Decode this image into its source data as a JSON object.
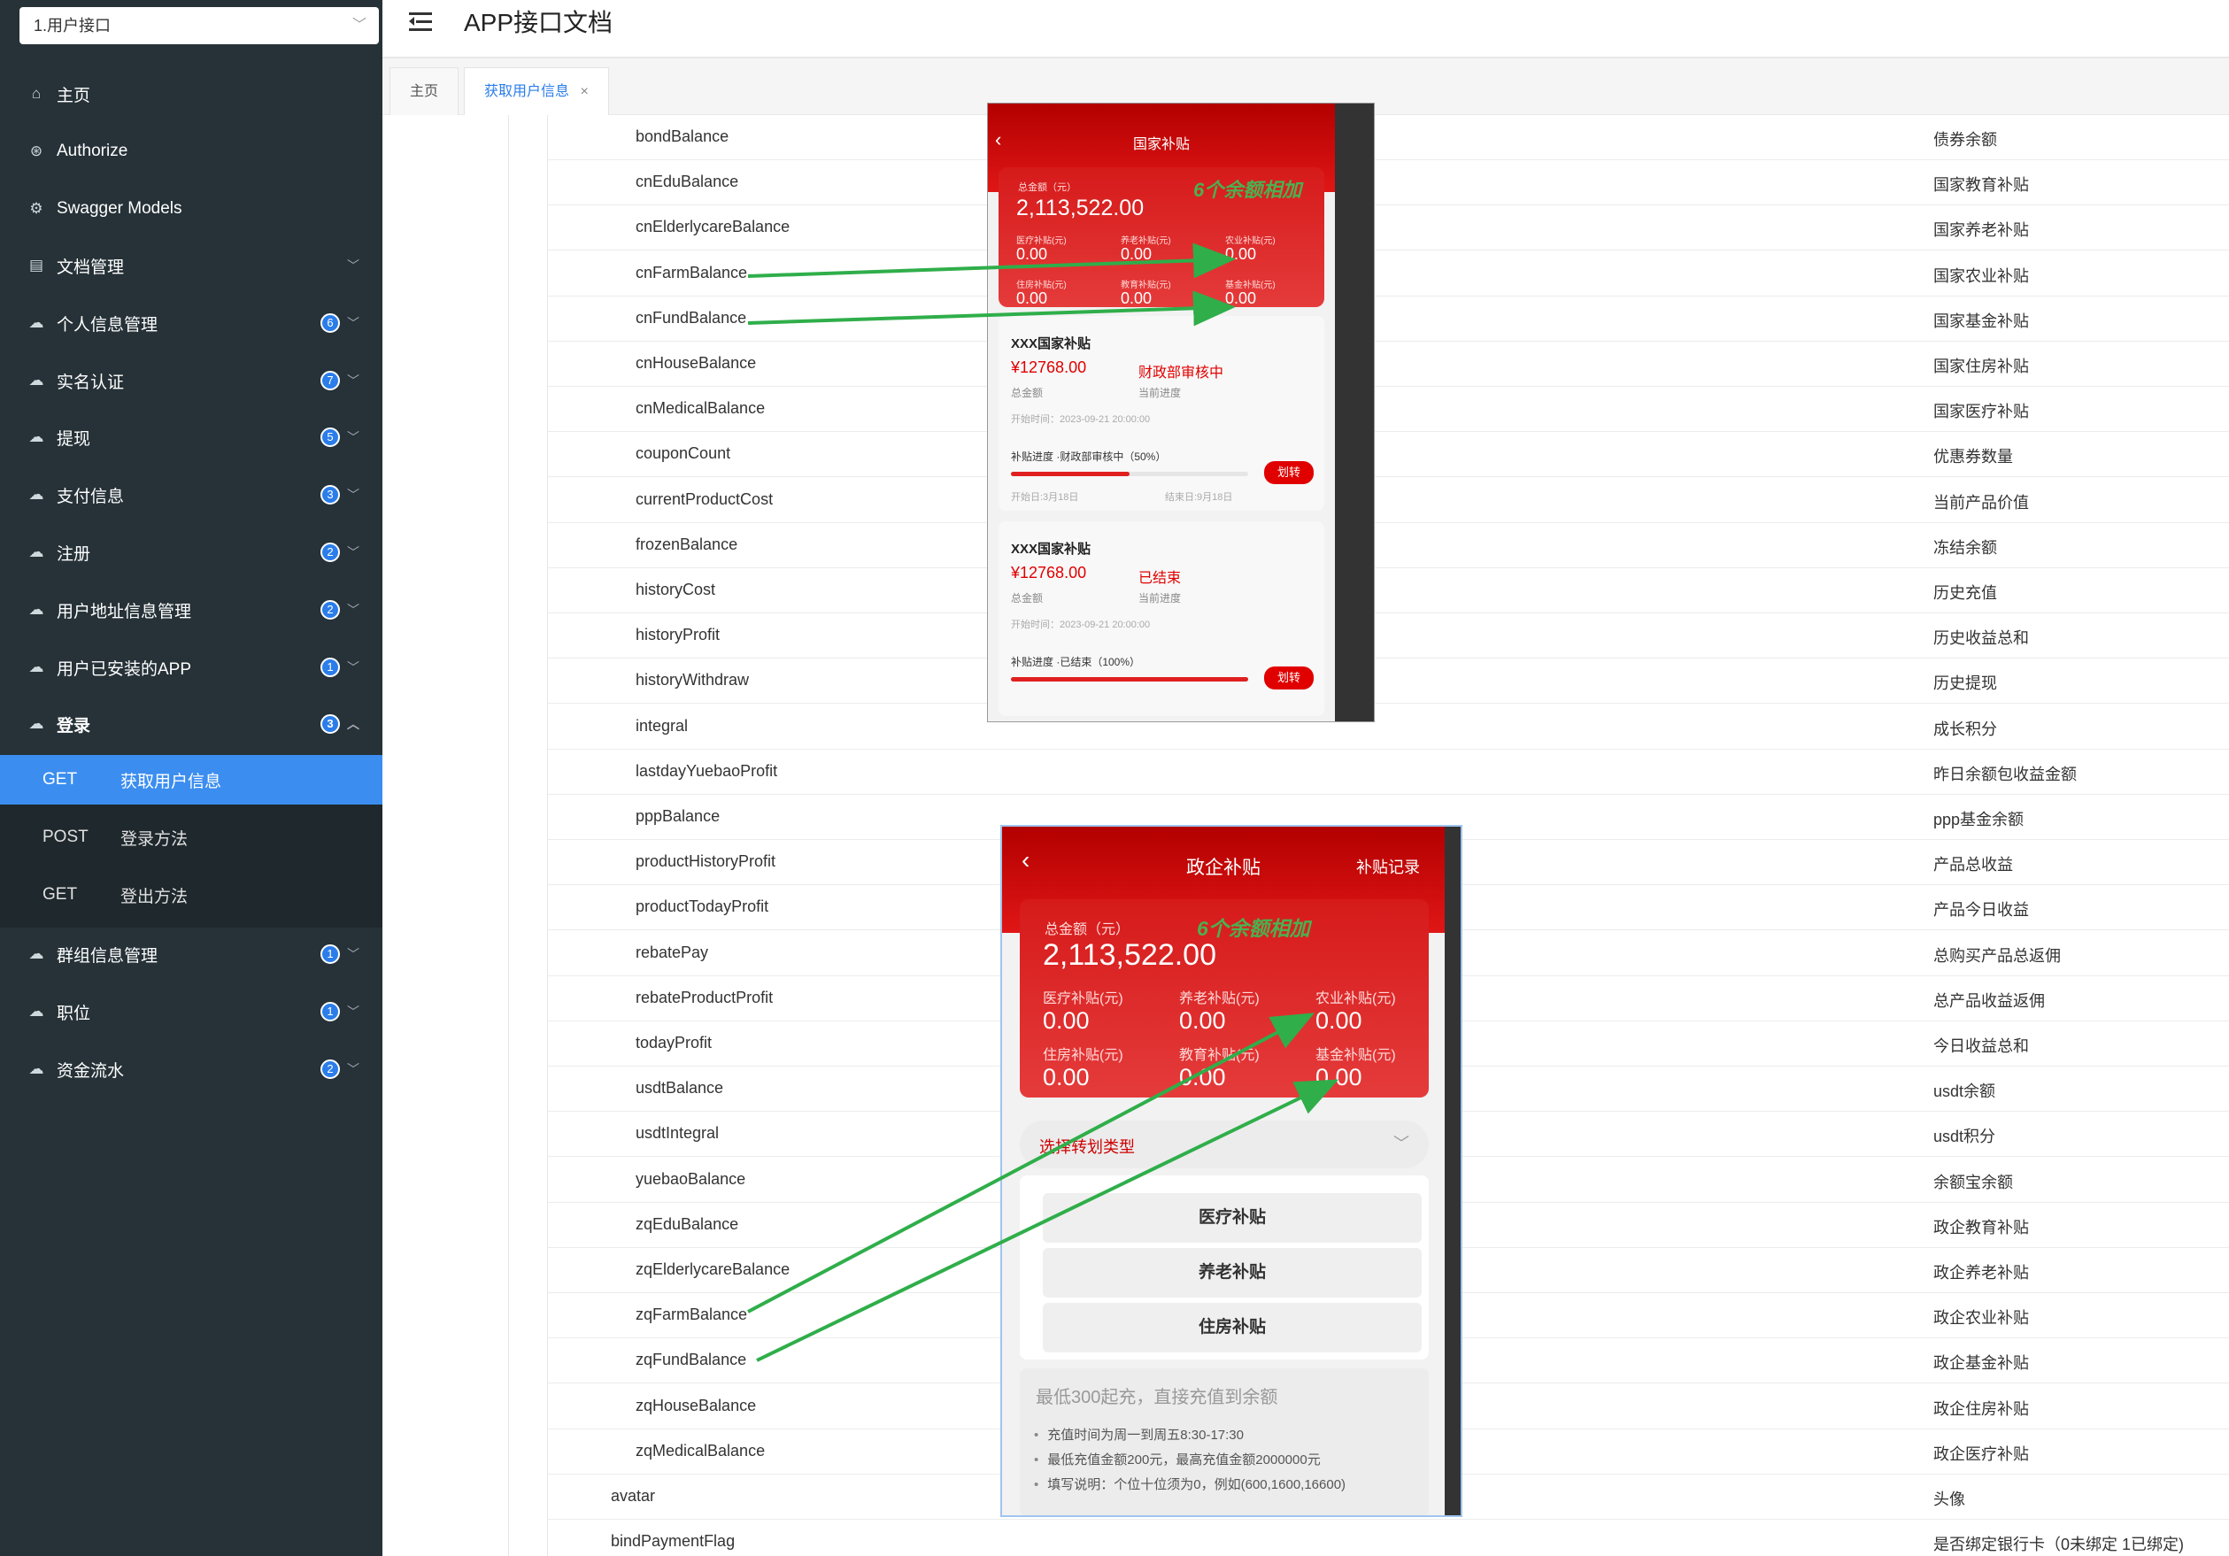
{
  "sidebar": {
    "api_select": "1.用户接口",
    "items": [
      {
        "label": "主页",
        "icon": "home-icon"
      },
      {
        "label": "Authorize",
        "icon": "lock-icon"
      },
      {
        "label": "Swagger Models",
        "icon": "cube-icon"
      },
      {
        "label": "文档管理",
        "icon": "docs-icon"
      },
      {
        "label": "个人信息管理",
        "icon": "cloud-icon",
        "badge": "6"
      },
      {
        "label": "实名认证",
        "icon": "cloud-icon",
        "badge": "7"
      },
      {
        "label": "提现",
        "icon": "cloud-icon",
        "badge": "5"
      },
      {
        "label": "支付信息",
        "icon": "cloud-icon",
        "badge": "3"
      },
      {
        "label": "注册",
        "icon": "cloud-icon",
        "badge": "2"
      },
      {
        "label": "用户地址信息管理",
        "icon": "cloud-icon",
        "badge": "2"
      },
      {
        "label": "用户已安装的APP",
        "icon": "cloud-icon",
        "badge": "1"
      },
      {
        "label": "登录",
        "icon": "cloud-icon",
        "badge": "3"
      },
      {
        "label": "群组信息管理",
        "icon": "cloud-icon",
        "badge": "1"
      },
      {
        "label": "职位",
        "icon": "cloud-icon",
        "badge": "1"
      },
      {
        "label": "资金流水",
        "icon": "cloud-icon",
        "badge": "2"
      }
    ],
    "sub_items": [
      {
        "method": "GET",
        "name": "获取用户信息",
        "active": true
      },
      {
        "method": "POST",
        "name": "登录方法",
        "active": false
      },
      {
        "method": "GET",
        "name": "登出方法",
        "active": false
      }
    ]
  },
  "header": {
    "title": "APP接口文档"
  },
  "tabs": [
    {
      "label": "主页"
    },
    {
      "label": "获取用户信息",
      "closable": "×"
    }
  ],
  "fields": [
    {
      "name": "bondBalance",
      "desc": "债券余额",
      "level": 2
    },
    {
      "name": "cnEduBalance",
      "desc": "国家教育补贴",
      "level": 2
    },
    {
      "name": "cnElderlycareBalance",
      "desc": "国家养老补贴",
      "level": 2
    },
    {
      "name": "cnFarmBalance",
      "desc": "国家农业补贴",
      "level": 2
    },
    {
      "name": "cnFundBalance",
      "desc": "国家基金补贴",
      "level": 2
    },
    {
      "name": "cnHouseBalance",
      "desc": "国家住房补贴",
      "level": 2
    },
    {
      "name": "cnMedicalBalance",
      "desc": "国家医疗补贴",
      "level": 2
    },
    {
      "name": "couponCount",
      "desc": "优惠券数量",
      "level": 2
    },
    {
      "name": "currentProductCost",
      "desc": "当前产品价值",
      "level": 2
    },
    {
      "name": "frozenBalance",
      "desc": "冻结余额",
      "level": 2
    },
    {
      "name": "historyCost",
      "desc": "历史充值",
      "level": 2
    },
    {
      "name": "historyProfit",
      "desc": "历史收益总和",
      "level": 2
    },
    {
      "name": "historyWithdraw",
      "desc": "历史提现",
      "level": 2
    },
    {
      "name": "integral",
      "desc": "成长积分",
      "level": 2
    },
    {
      "name": "lastdayYuebaoProfit",
      "desc": "昨日余额包收益金额",
      "level": 2
    },
    {
      "name": "pppBalance",
      "desc": "ppp基金余额",
      "level": 2
    },
    {
      "name": "productHistoryProfit",
      "desc": "产品总收益",
      "level": 2
    },
    {
      "name": "productTodayProfit",
      "desc": "产品今日收益",
      "level": 2
    },
    {
      "name": "rebatePay",
      "desc": "总购买产品总返佣",
      "level": 2
    },
    {
      "name": "rebateProductProfit",
      "desc": "总产品收益返佣",
      "level": 2
    },
    {
      "name": "todayProfit",
      "desc": "今日收益总和",
      "level": 2
    },
    {
      "name": "usdtBalance",
      "desc": "usdt余额",
      "level": 2
    },
    {
      "name": "usdtIntegral",
      "desc": "usdt积分",
      "level": 2
    },
    {
      "name": "yuebaoBalance",
      "desc": "余额宝余额",
      "level": 2
    },
    {
      "name": "zqEduBalance",
      "desc": "政企教育补贴",
      "level": 2
    },
    {
      "name": "zqElderlycareBalance",
      "desc": "政企养老补贴",
      "level": 2
    },
    {
      "name": "zqFarmBalance",
      "desc": "政企农业补贴",
      "level": 2
    },
    {
      "name": "zqFundBalance",
      "desc": "政企基金补贴",
      "level": 2
    },
    {
      "name": "zqHouseBalance",
      "desc": "政企住房补贴",
      "level": 2
    },
    {
      "name": "zqMedicalBalance",
      "desc": "政企医疗补贴",
      "level": 2
    },
    {
      "name": "avatar",
      "desc": "头像",
      "level": 1
    },
    {
      "name": "bindPaymentFlag",
      "desc": "是否绑定银行卡（0未绑定 1已绑定)",
      "level": 1
    }
  ],
  "phone1": {
    "title": "国家补贴",
    "total_label": "总金额（元）",
    "total": "2,113,522.00",
    "annotation": "6个余额相加",
    "stats": [
      {
        "label": "医疗补贴(元)",
        "value": "0.00"
      },
      {
        "label": "养老补贴(元)",
        "value": "0.00"
      },
      {
        "label": "农业补贴(元)",
        "value": "0.00"
      },
      {
        "label": "住房补贴(元)",
        "value": "0.00"
      },
      {
        "label": "教育补贴(元)",
        "value": "0.00"
      },
      {
        "label": "基金补贴(元)",
        "value": "0.00"
      }
    ],
    "cards": [
      {
        "title": "XXX国家补贴",
        "amount": "¥12768.00",
        "amount_label": "总金额",
        "status": "财政部审核中",
        "status_label": "当前进度",
        "start_time": "开始时间：2023-09-21 20:00:00",
        "progress_label": "补贴进度 ·财政部审核中（50%）",
        "progress": 0.5,
        "button": "划转",
        "start_date": "开始日:3月18日",
        "end_date": "结束日:9月18日"
      },
      {
        "title": "XXX国家补贴",
        "amount": "¥12768.00",
        "amount_label": "总金额",
        "status": "已结束",
        "status_label": "当前进度",
        "start_time": "开始时间：2023-09-21 20:00:00",
        "progress_label": "补贴进度 ·已结束（100%）",
        "progress": 1.0,
        "button": "划转"
      }
    ]
  },
  "phone2": {
    "title": "政企补贴",
    "record_link": "补贴记录",
    "total_label": "总金额（元）",
    "total": "2,113,522.00",
    "annotation": "6个余额相加",
    "stats": [
      {
        "label": "医疗补贴(元)",
        "value": "0.00"
      },
      {
        "label": "养老补贴(元)",
        "value": "0.00"
      },
      {
        "label": "农业补贴(元)",
        "value": "0.00"
      },
      {
        "label": "住房补贴(元)",
        "value": "0.00"
      },
      {
        "label": "教育补贴(元)",
        "value": "0.00"
      },
      {
        "label": "基金补贴(元)",
        "value": "0.00"
      }
    ],
    "select_label": "选择转划类型",
    "options": [
      "医疗补贴",
      "养老补贴",
      "住房补贴"
    ],
    "hint": "最低300起充，直接充值到余额",
    "notes": [
      "充值时间为周一到周五8:30-17:30",
      "最低充值金额200元，最高充值金额2000000元",
      "填写说明：个位十位须为0，例如(600,1600,16600)"
    ]
  },
  "colors": {
    "sidebar_bg": "#263238",
    "active_blue": "#3b8ef0",
    "badge_blue": "#2b7de9",
    "phone_red": "#e01616",
    "arrow_green": "#2fae4a"
  }
}
